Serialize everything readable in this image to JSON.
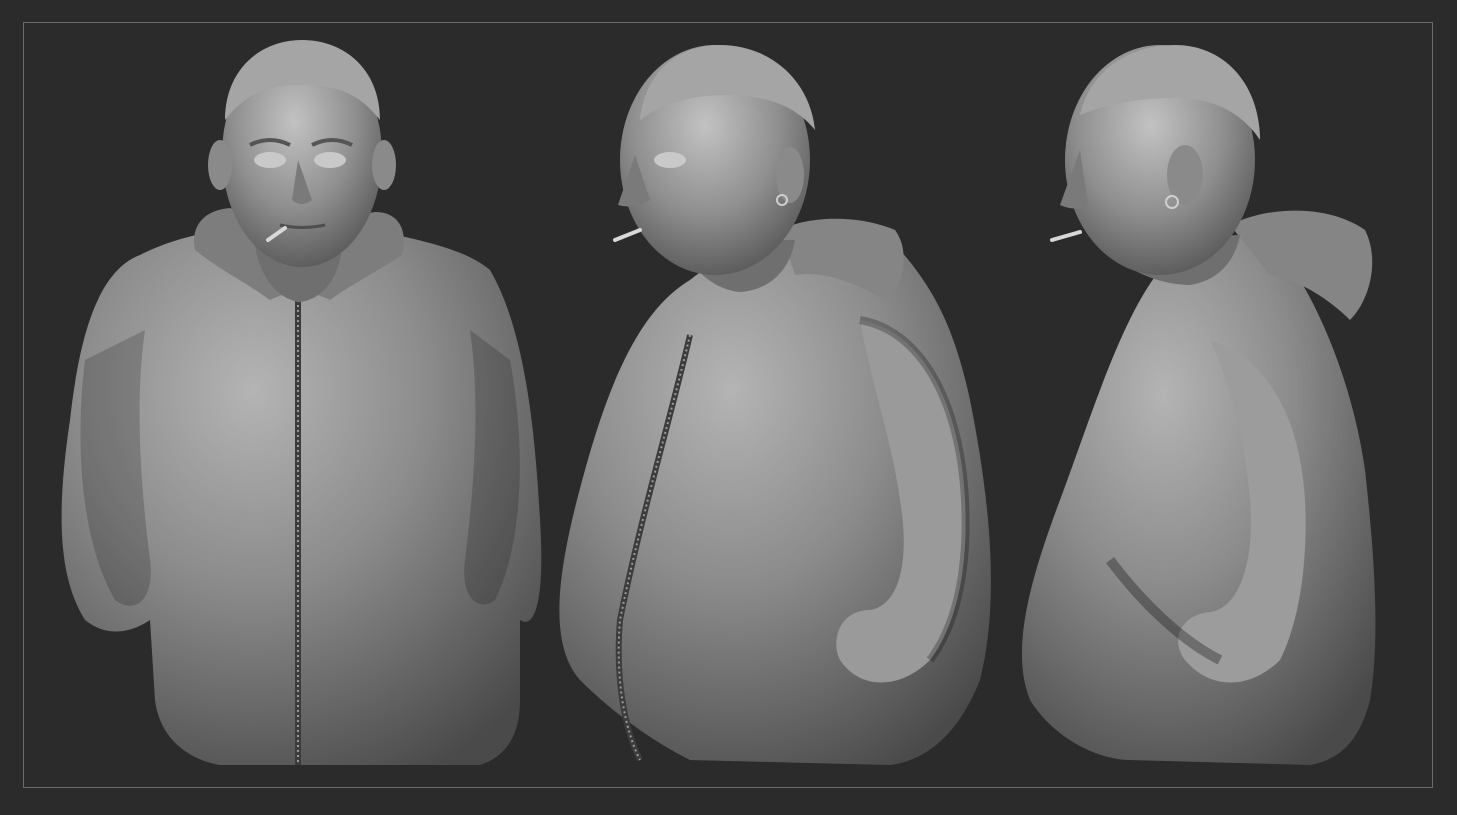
{
  "scene": {
    "background_color": "#2b2b2b",
    "frame_color": "#6a6a6a",
    "material_color": "#8e8e8e",
    "views": [
      {
        "name": "front-view"
      },
      {
        "name": "three-quarter-view"
      },
      {
        "name": "side-view"
      }
    ]
  }
}
